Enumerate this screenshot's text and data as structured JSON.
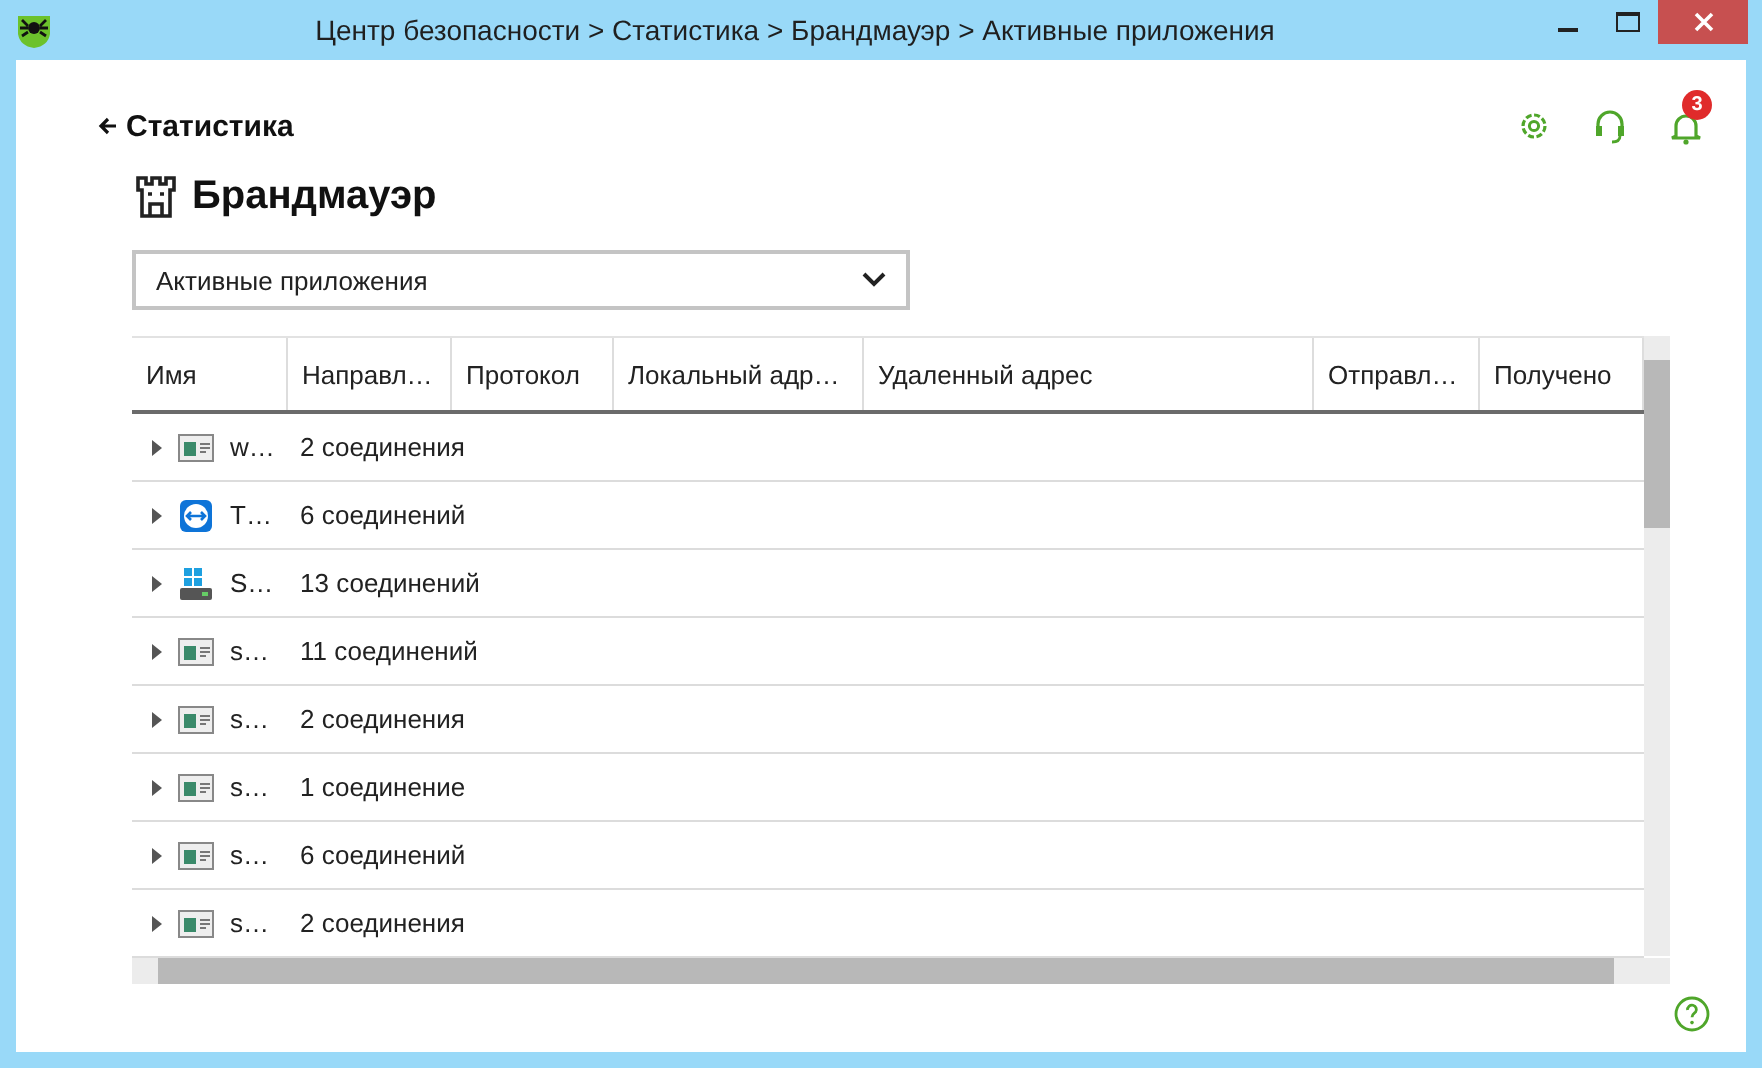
{
  "window": {
    "title": "Центр безопасности > Статистика > Брандмауэр > Активные приложения"
  },
  "back_link": "Статистика",
  "toolbar": {
    "notification_count": "3"
  },
  "heading": "Брандмауэр",
  "view_select": {
    "value": "Активные приложения"
  },
  "table": {
    "columns": [
      "Имя",
      "Направл…",
      "Протокол",
      "Локальный адр…",
      "Удаленный адрес",
      "Отправл…",
      "Получено"
    ],
    "rows": [
      {
        "kind": "window",
        "name": "w…",
        "direction": "2 соединения",
        "expanded": false
      },
      {
        "kind": "remote",
        "name": "T…",
        "direction": "6 соединений",
        "expanded": false
      },
      {
        "kind": "server",
        "name": "S…",
        "direction": "13 соединений",
        "expanded": false
      },
      {
        "kind": "window",
        "name": "s…",
        "direction": "11 соединений",
        "expanded": false
      },
      {
        "kind": "window",
        "name": "s…",
        "direction": "2 соединения",
        "expanded": false
      },
      {
        "kind": "window",
        "name": "s…",
        "direction": "1 соединение",
        "expanded": false
      },
      {
        "kind": "window",
        "name": "s…",
        "direction": "6 соединений",
        "expanded": false
      },
      {
        "kind": "window",
        "name": "s…",
        "direction": "2 соединения",
        "expanded": false
      }
    ]
  }
}
